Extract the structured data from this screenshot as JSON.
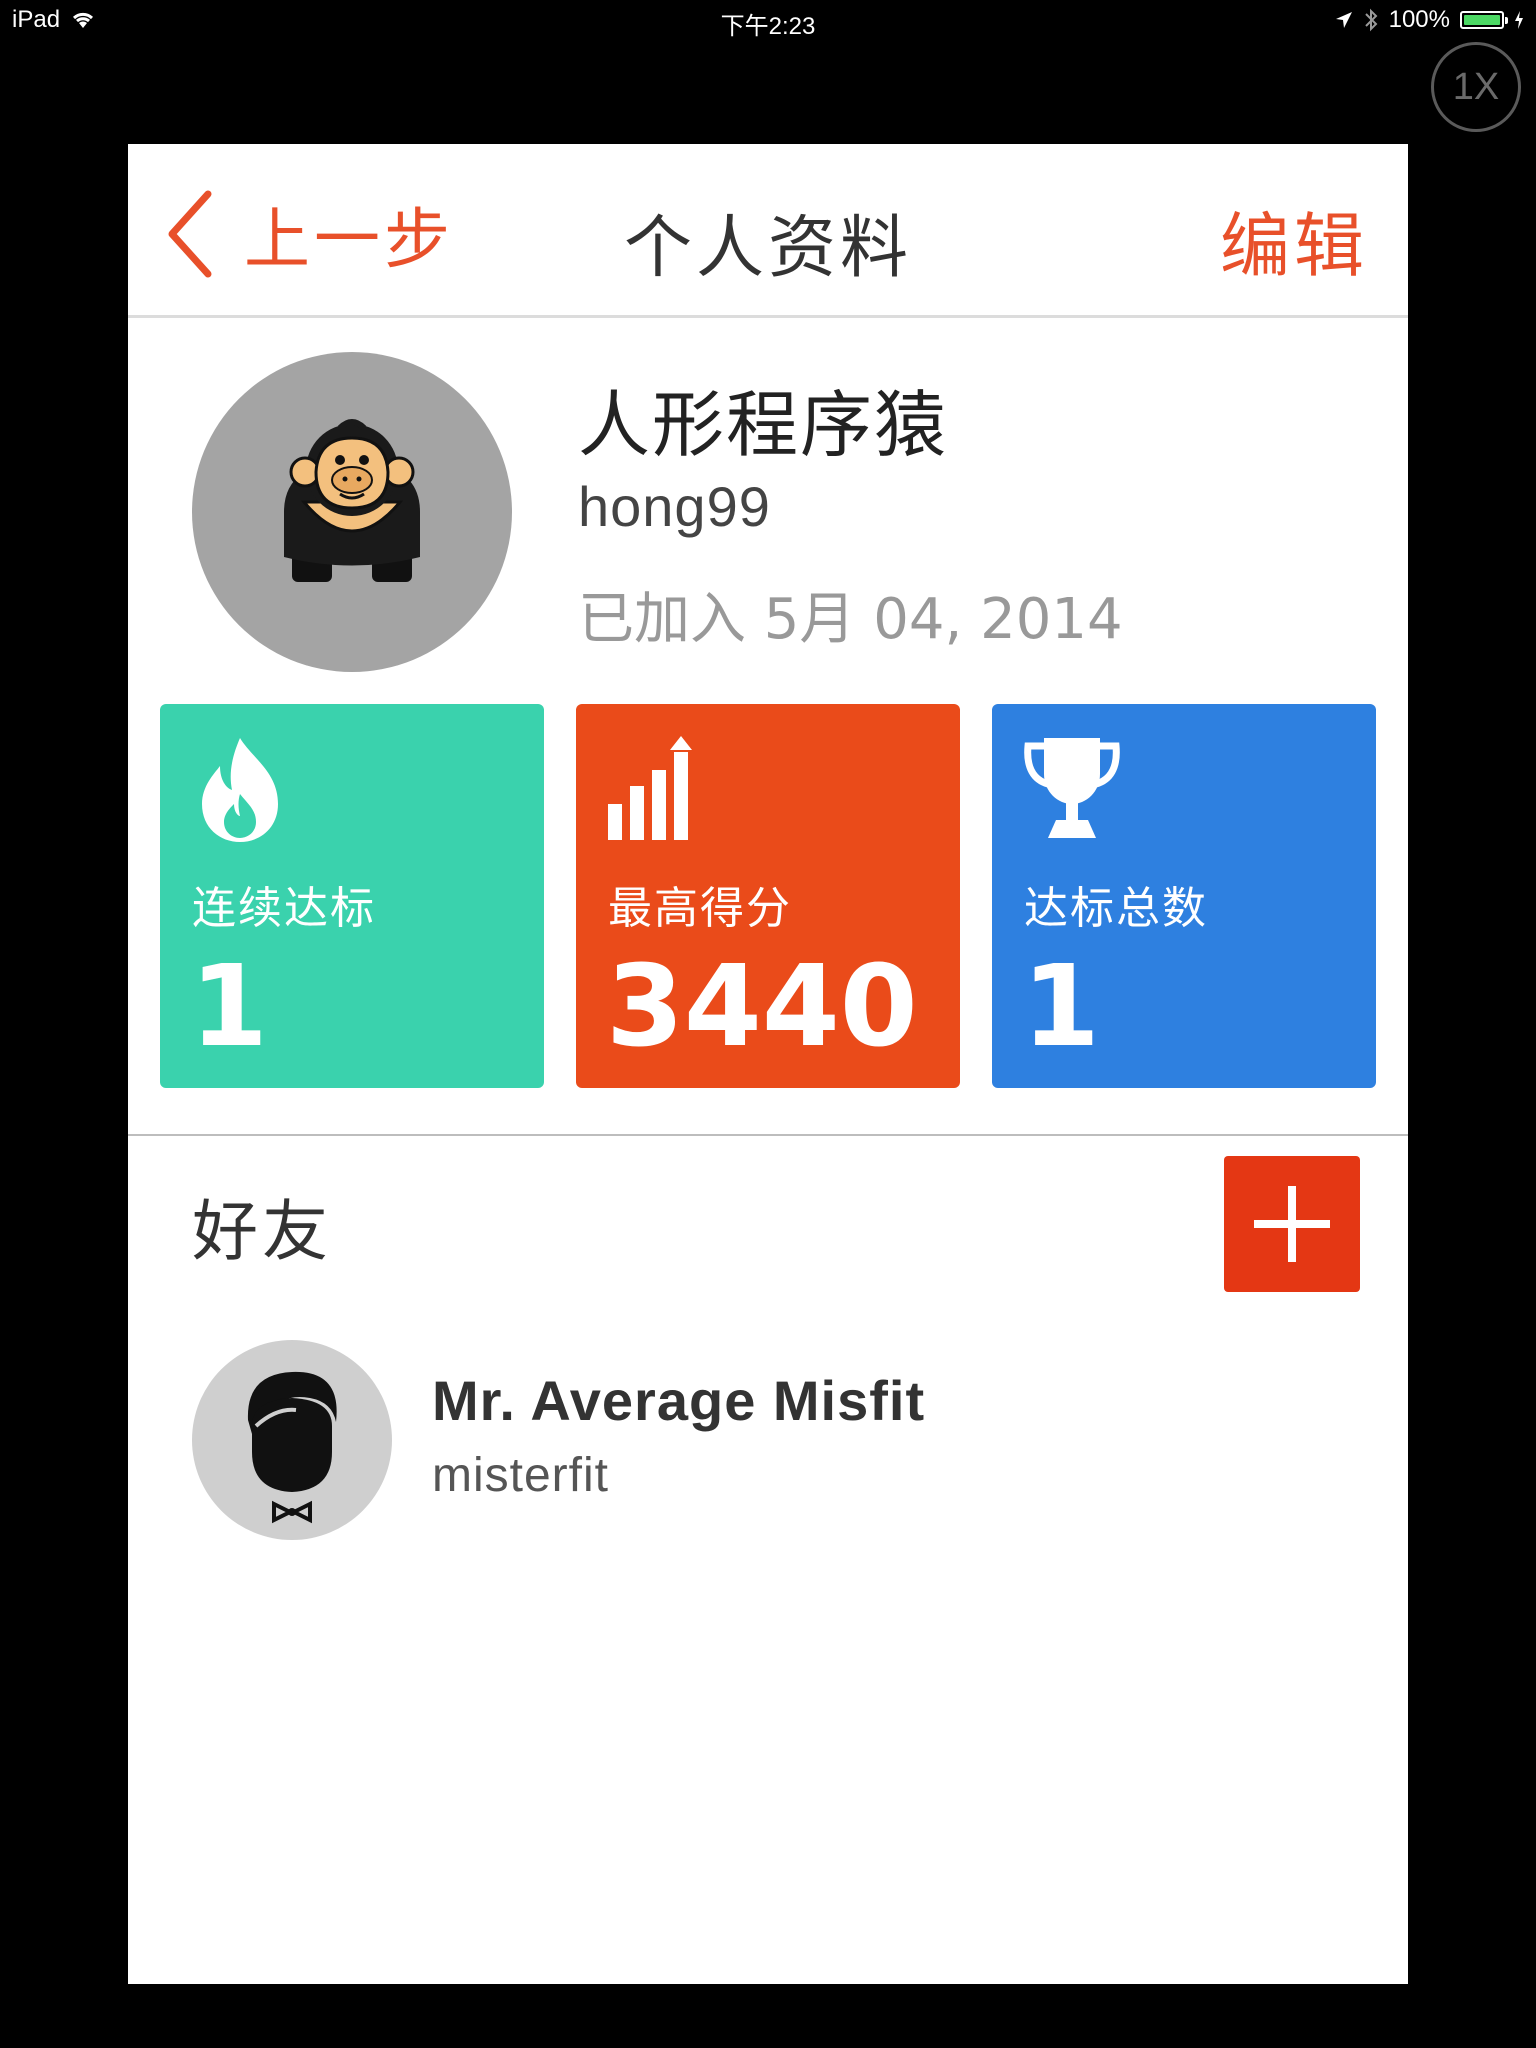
{
  "status_bar": {
    "device": "iPad",
    "time": "下午2:23",
    "battery": "100%",
    "battery_level": 1.0
  },
  "zoom_badge": "1X",
  "nav": {
    "back_label": "上一步",
    "title": "个人资料",
    "edit_label": "编辑"
  },
  "profile": {
    "name": "人形程序猿",
    "username": "hong99",
    "joined": "已加入 5月 04, 2014"
  },
  "stats": [
    {
      "label": "连续达标",
      "value": "1",
      "color": "#3ad2ad",
      "icon": "flame-icon"
    },
    {
      "label": "最高得分",
      "value": "3440",
      "color": "#ea4b1a",
      "icon": "bar-chart-icon"
    },
    {
      "label": "达标总数",
      "value": "1",
      "color": "#2e80e0",
      "icon": "trophy-icon"
    }
  ],
  "friends": {
    "title": "好友",
    "add_color": "#e43714",
    "items": [
      {
        "name": "Mr. Average Misfit",
        "username": "misterfit"
      }
    ]
  }
}
